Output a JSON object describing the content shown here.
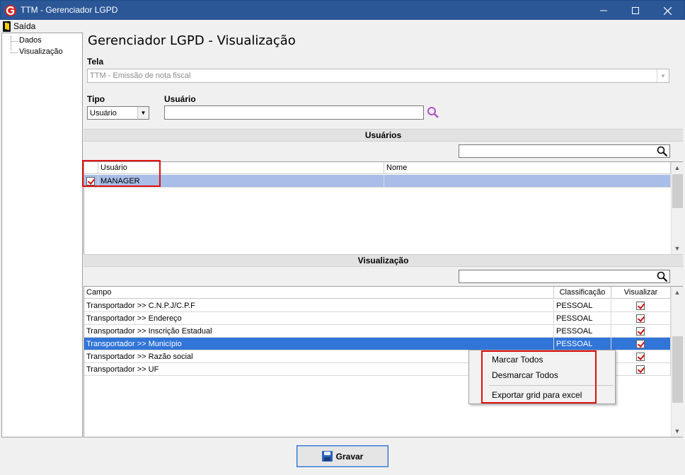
{
  "window": {
    "title": "TTM - Gerenciador LGPD"
  },
  "menubar": {
    "saida": "Saída"
  },
  "tree": {
    "items": [
      "Dados",
      "Visualização"
    ]
  },
  "page": {
    "title": "Gerenciador LGPD - Visualização"
  },
  "form": {
    "tela_label": "Tela",
    "tela_value": "TTM - Emissão de nota fiscal",
    "tipo_label": "Tipo",
    "tipo_value": "Usuário",
    "usuario_label": "Usuário",
    "usuario_value": ""
  },
  "usuarios_section": {
    "header": "Usuários",
    "filter_value": "",
    "columns": [
      "Usuário",
      "Nome"
    ],
    "rows": [
      {
        "checked": true,
        "usuario": "MANAGER",
        "nome": ""
      }
    ]
  },
  "visualizacao_section": {
    "header": "Visualização",
    "filter_value": "",
    "columns": [
      "Campo",
      "Classificação",
      "Visualizar"
    ],
    "rows": [
      {
        "campo": "Transportador >> C.N.P.J/C.P.F",
        "classificacao": "PESSOAL",
        "visualizar": true
      },
      {
        "campo": "Transportador >> Endereço",
        "classificacao": "PESSOAL",
        "visualizar": true
      },
      {
        "campo": "Transportador >> Inscrição Estadual",
        "classificacao": "PESSOAL",
        "visualizar": true
      },
      {
        "campo": "Transportador >> Município",
        "classificacao": "PESSOAL",
        "visualizar": true
      },
      {
        "campo": "Transportador >> Razão social",
        "classificacao": "",
        "visualizar": true
      },
      {
        "campo": "Transportador >> UF",
        "classificacao": "",
        "visualizar": true
      }
    ]
  },
  "context_menu": {
    "items": [
      "Marcar Todos",
      "Desmarcar Todos",
      "Exportar grid para excel"
    ]
  },
  "buttons": {
    "gravar": "Gravar"
  },
  "colors": {
    "titlebar": "#2b5797",
    "selection_light": "#a8bde8",
    "selection_dark": "#3175d8",
    "highlight_frame": "#e01010",
    "search_icon": "#b050c8"
  }
}
